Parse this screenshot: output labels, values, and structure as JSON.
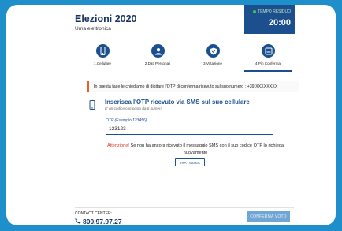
{
  "header": {
    "title": "Elezioni 2020",
    "subtitle": "Urna elettronica",
    "timer_label": "TEMPO RESIDUO",
    "timer_value": "20:00"
  },
  "steps": [
    {
      "label": "1.Cellulare",
      "icon": "mobile-phone-icon",
      "active": false
    },
    {
      "label": "2.Dati Personali",
      "icon": "user-icon",
      "active": false
    },
    {
      "label": "3.Votazione",
      "icon": "shield-check-icon",
      "active": false
    },
    {
      "label": "4.Pin Conferma",
      "icon": "keypad-icon",
      "active": true
    }
  ],
  "info_message": "In questa fase le chiediamo di digitare l'OTP di conferma ricevuto sul suo numero : +39 XXXXXXXX",
  "sms": {
    "title": "Inserisca l'OTP ricevuto via SMS sul suo cellulare",
    "subtitle": "E' un codice composto da 6 numeri"
  },
  "otp": {
    "label": "OTP (Esempio 123456)",
    "value": "123123"
  },
  "warning": {
    "strong": "Attenzione!",
    "text": " Se non ha ancora ricevuto il messaggio SMS con il suo codice OTP lo richieda nuovamente",
    "resend_label": "TRA - 60SEC"
  },
  "footer": {
    "contact_label": "CONTACT CENTER:",
    "contact_phone": "800.97.97.27",
    "confirm_label": "CONFERMA VOTO"
  },
  "colors": {
    "background": "#1f8fcb",
    "primary": "#1b4f8e",
    "accent": "#e0622b",
    "warning": "#d23b2b",
    "confirm_disabled": "#6fa6d4"
  }
}
